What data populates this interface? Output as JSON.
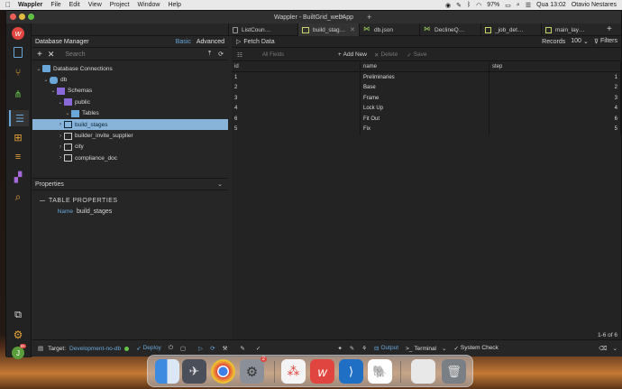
{
  "menubar": {
    "app": "Wappler",
    "items": [
      "File",
      "Edit",
      "View",
      "Project",
      "Window",
      "Help"
    ],
    "battery": "97%",
    "clock": "Qua 13:02",
    "user": "Otavio Nestares"
  },
  "window": {
    "title": "Wappler - BuiltGrid_webApp",
    "tabs": [
      {
        "label": "ListCoun…",
        "active": false
      },
      {
        "label": "build_stag…",
        "active": true
      },
      {
        "label": "db.json",
        "active": false
      },
      {
        "label": "DeclineQ…",
        "active": false
      },
      {
        "label": "_job_det…",
        "active": false
      },
      {
        "label": "main_lay…",
        "active": false
      }
    ]
  },
  "db_manager": {
    "title": "Database Manager",
    "mode_basic": "Basic",
    "mode_advanced": "Advanced",
    "search_placeholder": "Search",
    "tree": [
      {
        "label": "Database Connections",
        "depth": 0,
        "icon": "connections-icon"
      },
      {
        "label": "db",
        "depth": 1,
        "icon": "database-icon"
      },
      {
        "label": "Schemas",
        "depth": 2,
        "icon": "schemas-icon"
      },
      {
        "label": "public",
        "depth": 3,
        "icon": "schema-icon"
      },
      {
        "label": "Tables",
        "depth": 4,
        "icon": "folder-icon"
      },
      {
        "label": "build_stages",
        "depth": 5,
        "icon": "table-icon",
        "selected": true
      },
      {
        "label": "builder_invite_supplier",
        "depth": 5,
        "icon": "table-icon"
      },
      {
        "label": "city",
        "depth": 5,
        "icon": "table-icon"
      },
      {
        "label": "compliance_doc",
        "depth": 5,
        "icon": "table-icon"
      }
    ]
  },
  "properties": {
    "title": "Properties",
    "section": "TABLE PROPERTIES",
    "name_label": "Name",
    "name_value": "build_stages"
  },
  "data_view": {
    "fetch_label": "Fetch Data",
    "records_label": "Records",
    "records_value": "100",
    "filters_label": "Filters",
    "all_fields_placeholder": "All Fields",
    "add_new_label": "Add New",
    "delete_label": "Delete",
    "save_label": "Save",
    "columns": [
      "id",
      "name",
      "step"
    ],
    "rows": [
      [
        "1",
        "Preliminaries",
        "1"
      ],
      [
        "2",
        "Base",
        "2"
      ],
      [
        "3",
        "Frame",
        "3"
      ],
      [
        "4",
        "Lock Up",
        "4"
      ],
      [
        "6",
        "Fit Out",
        "6"
      ],
      [
        "5",
        "Fix",
        "5"
      ]
    ],
    "pager": "1-6 of 6"
  },
  "statusbar": {
    "target_label": "Target:",
    "target_value": "Development-no-db",
    "deploy_label": "Deploy",
    "output_label": "Output",
    "terminal_label": "Terminal",
    "system_check_label": "System Check"
  },
  "colors": {
    "accent": "#6aa7d8",
    "selected_row": "#87b4d8",
    "brand_red": "#e0463f"
  },
  "dock": {
    "badge_settings": "2"
  },
  "avatar_badge": "9+"
}
